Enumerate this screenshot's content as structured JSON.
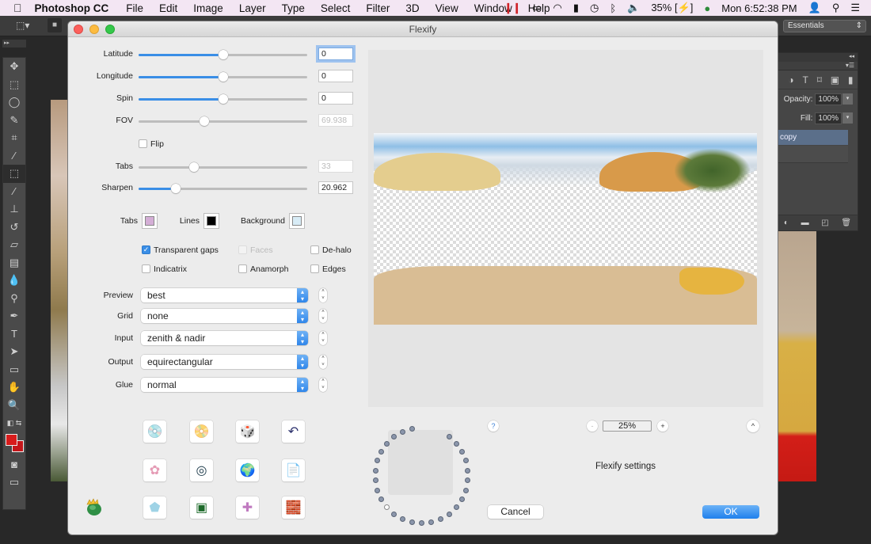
{
  "menubar": {
    "apple": "",
    "app_name": "Photoshop CC",
    "items": [
      "File",
      "Edit",
      "Image",
      "Layer",
      "Type",
      "Select",
      "Filter",
      "3D",
      "View",
      "Window",
      "Help"
    ],
    "status": {
      "battery": "35%",
      "clock": "Mon 6:52:38 PM"
    }
  },
  "photoshop": {
    "workspace": "Essentials",
    "layers": {
      "opacity_label": "Opacity:",
      "opacity": "100%",
      "fill_label": "Fill:",
      "fill": "100%",
      "selected_layer": "copy"
    },
    "tools": [
      "move",
      "marquee",
      "lasso",
      "quick-select",
      "crop",
      "eyedropper",
      "patch",
      "brush",
      "stamp",
      "history-brush",
      "eraser",
      "gradient",
      "blur",
      "dodge",
      "pen",
      "type",
      "path-select",
      "rectangle",
      "hand",
      "zoom"
    ],
    "foreground_color": "#d81c1c",
    "background_color": "#c4161a"
  },
  "dialog": {
    "title": "Flexify",
    "sliders": [
      {
        "label": "Latitude",
        "value": "0",
        "fraction": 0.5,
        "enabled": true,
        "focused": true
      },
      {
        "label": "Longitude",
        "value": "0",
        "fraction": 0.5,
        "enabled": true
      },
      {
        "label": "Spin",
        "value": "0",
        "fraction": 0.5,
        "enabled": true
      },
      {
        "label": "FOV",
        "value": "69.938",
        "fraction": 0.39,
        "enabled": false
      },
      {
        "label": "Tabs",
        "value": "33",
        "fraction": 0.33,
        "enabled": false
      },
      {
        "label": "Sharpen",
        "value": "20.962",
        "fraction": 0.22,
        "enabled": true
      }
    ],
    "flip_label": "Flip",
    "flip_checked": false,
    "colors": {
      "tabs_label": "Tabs",
      "tabs_color": "#d4aed6",
      "lines_label": "Lines",
      "lines_color": "#000000",
      "background_label": "Background",
      "background_color": "#d8ecf6"
    },
    "checkboxes": [
      {
        "label": "Transparent gaps",
        "checked": true,
        "enabled": true
      },
      {
        "label": "Faces",
        "checked": false,
        "enabled": false
      },
      {
        "label": "De-halo",
        "checked": false,
        "enabled": true
      },
      {
        "label": "Indicatrix",
        "checked": false,
        "enabled": true
      },
      {
        "label": "Anamorph",
        "checked": false,
        "enabled": true
      },
      {
        "label": "Edges",
        "checked": false,
        "enabled": true
      }
    ],
    "selects": [
      {
        "label": "Preview",
        "value": "best"
      },
      {
        "label": "Grid",
        "value": "none"
      },
      {
        "label": "Input",
        "value": "zenith & nadir"
      },
      {
        "label": "Output",
        "value": "equirectangular"
      },
      {
        "label": "Glue",
        "value": "normal"
      }
    ],
    "presets": [
      {
        "name": "load-cd-icon",
        "glyph": "💿"
      },
      {
        "name": "save-cd-icon",
        "glyph": "📀"
      },
      {
        "name": "random-dice-icon",
        "glyph": "🎲"
      },
      {
        "name": "undo-arrow-icon",
        "glyph": "↶"
      },
      {
        "name": "photos-icon",
        "glyph": "✿"
      },
      {
        "name": "torus-icon",
        "glyph": "◎"
      },
      {
        "name": "little-planet-icon",
        "glyph": "🌍"
      },
      {
        "name": "file-icon",
        "glyph": "📄"
      },
      {
        "name": "pentagon-icon",
        "glyph": "⬟"
      },
      {
        "name": "green-frame-icon",
        "glyph": "▣"
      },
      {
        "name": "cube-net-icon",
        "glyph": "✚"
      },
      {
        "name": "lego-brick-icon",
        "glyph": "🧱"
      }
    ],
    "zoom": {
      "minus": "-",
      "value": "25%",
      "plus": "+"
    },
    "help": "?",
    "collapse": "^",
    "settings_text": "Flexify settings",
    "cancel": "Cancel",
    "ok": "OK"
  }
}
